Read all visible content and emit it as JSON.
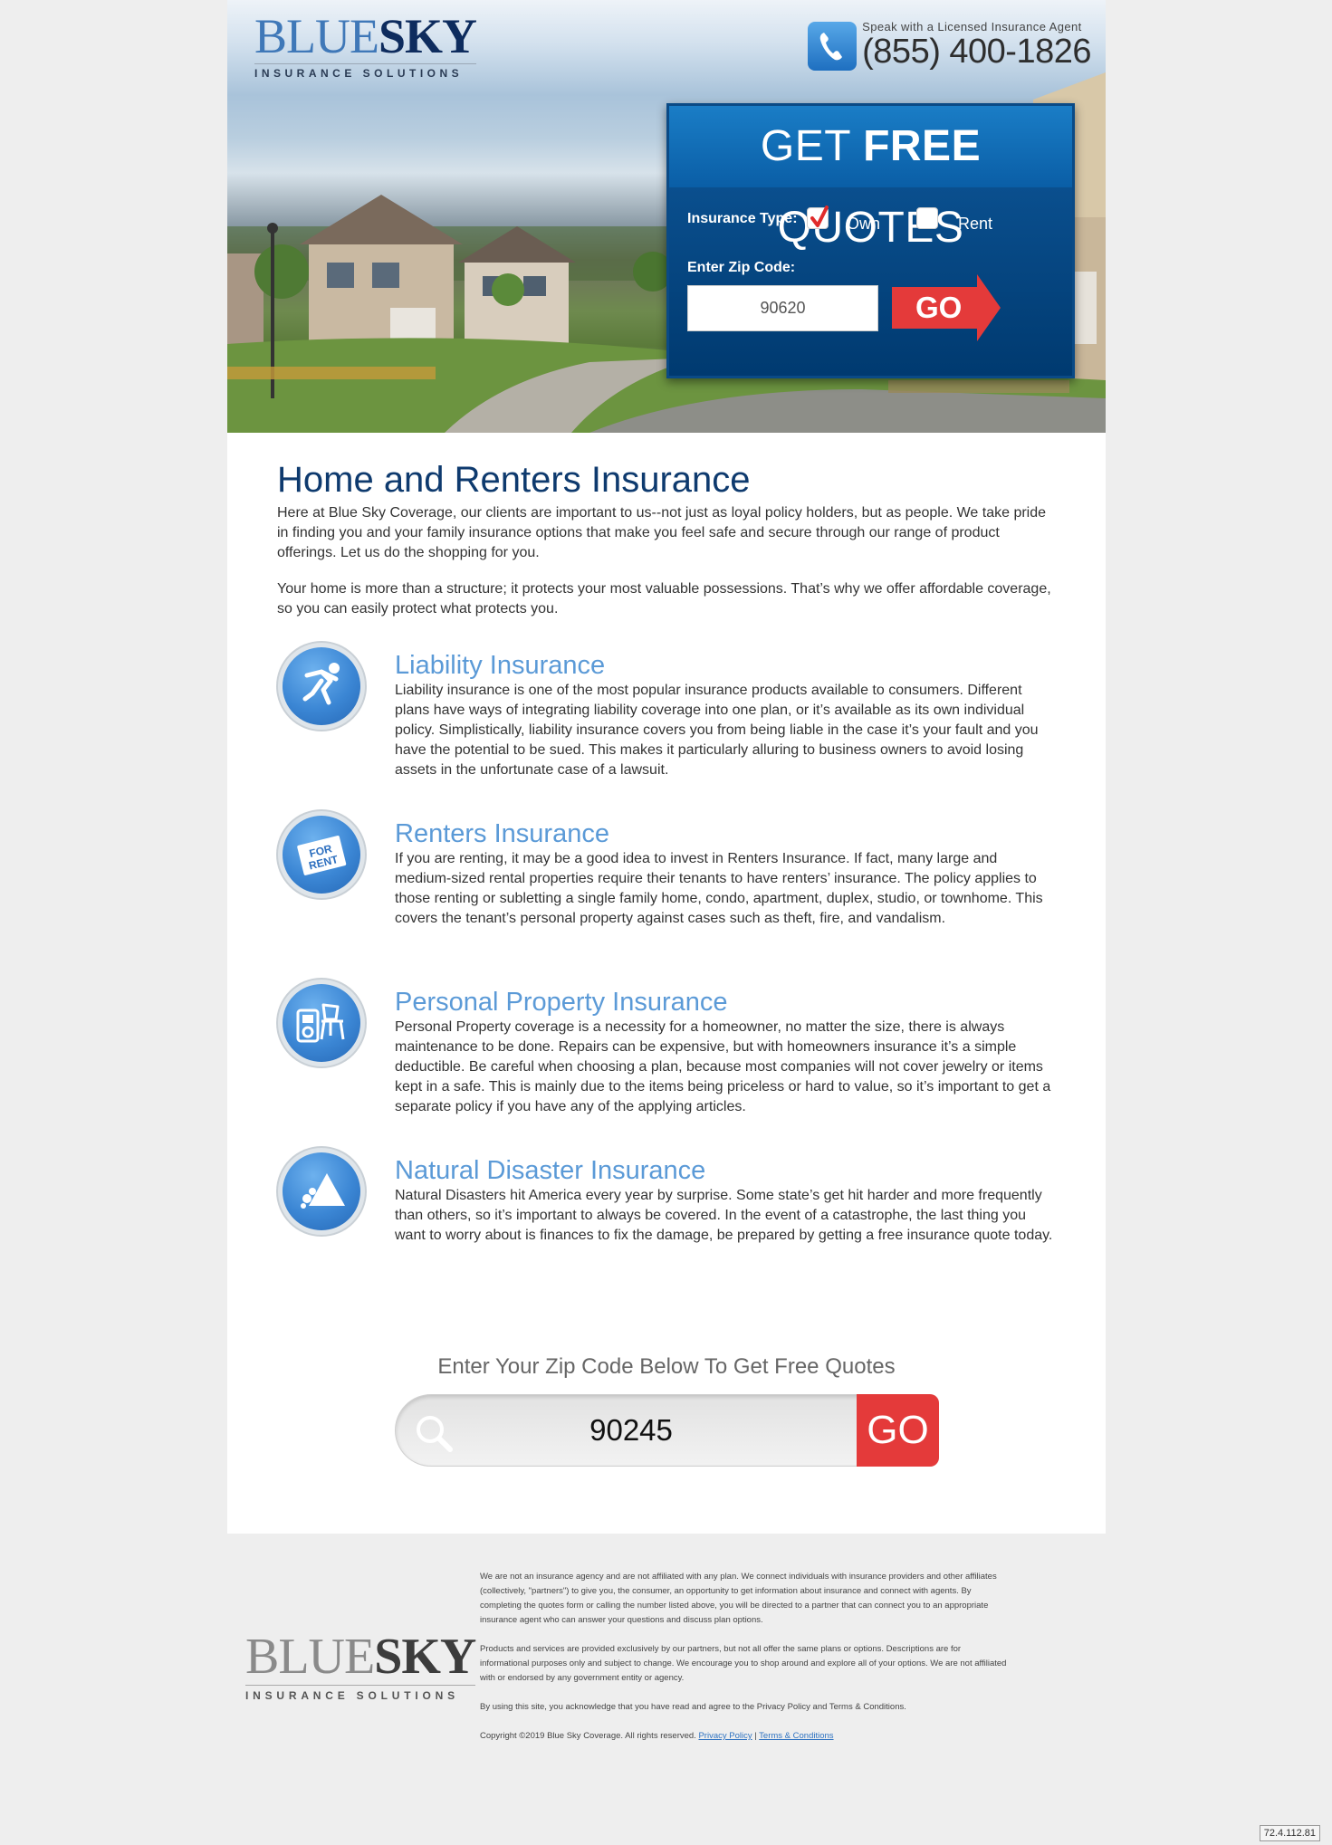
{
  "brand": {
    "name_part1": "BLUE",
    "name_part2": "SKY",
    "tagline": "INSURANCE SOLUTIONS"
  },
  "phone": {
    "label": "Speak with a Licensed Insurance Agent",
    "number": "(855) 400-1826"
  },
  "quote_form": {
    "title_part1": "GET ",
    "title_bold": "FREE",
    "title_part2": " QUOTES",
    "insurance_type_label": "Insurance Type:",
    "options": [
      {
        "label": "Own",
        "checked": true
      },
      {
        "label": "Rent",
        "checked": false
      }
    ],
    "zip_label": "Enter Zip Code:",
    "zip_value": "90620",
    "go_label": "GO"
  },
  "main": {
    "title": "Home and Renters Insurance",
    "intro": [
      "Here at Blue Sky Coverage, our clients are important to us--not just as loyal policy holders, but as people. We take pride in finding you and your family insurance options that make you feel safe and secure through our range of product offerings. Let us do the shopping for you.",
      "Your home is more than a structure; it protects your most valuable possessions. That’s why we offer affordable coverage, so you can easily protect what protects you."
    ],
    "services": [
      {
        "icon": "falling-person-icon",
        "title": "Liability Insurance",
        "text": "Liability insurance is one of the most popular insurance products available to consumers. Different plans have ways of integrating liability coverage into one plan, or it’s available as its own individual policy. Simplistically, liability insurance covers you from being liable in the case it’s your fault and you have the potential to be sued. This makes it particularly alluring to business owners to avoid losing assets in the unfortunate case of a lawsuit."
      },
      {
        "icon": "for-rent-sign-icon",
        "icon_text_1": "FOR",
        "icon_text_2": "RENT",
        "title": "Renters Insurance",
        "text": "If you are renting, it may be a good idea to invest in Renters Insurance. If fact, many large and medium-sized rental properties require their tenants to have renters’ insurance. The policy applies to those renting or subletting a single family home, condo, apartment, duplex, studio, or townhome. This covers the tenant’s personal property against cases such as theft, fire, and vandalism."
      },
      {
        "icon": "ipod-and-chair-icon",
        "title": "Personal Property Insurance",
        "text": "Personal Property coverage is a necessity for a homeowner, no matter the size, there is always maintenance to be done. Repairs can be expensive, but with homeowners insurance it’s a simple deductible. Be careful when choosing a plan, because most companies will not cover jewelry or items kept in a safe. This is mainly due to the items being priceless or hard to value, so it’s important to get a separate policy if you have any of the applying articles."
      },
      {
        "icon": "rockslide-warning-icon",
        "title": "Natural Disaster Insurance",
        "text": "Natural Disasters hit America every year by surprise. Some state’s get hit harder and more frequently than others, so it’s important to always be covered. In the event of a catastrophe, the last thing you want to worry about is finances to fix the damage, be prepared by getting a free insurance quote today."
      }
    ]
  },
  "zip_cta": {
    "title": "Enter Your Zip Code Below To Get Free Quotes",
    "value": "90245",
    "go_label": "GO"
  },
  "footer": {
    "paragraph1": "We are not an insurance agency and are not affiliated with any plan. We connect individuals with insurance providers and other affiliates (collectively, \"partners\") to give you, the consumer, an opportunity to get information about insurance and connect with agents. By completing the quotes form or calling the number listed above, you will be directed to a partner that can connect you to an appropriate insurance agent who can answer your questions and discuss plan options.",
    "paragraph2": "Products and services are provided exclusively by our partners, but not all offer the same plans or options. Descriptions are for informational purposes only and subject to change. We encourage you to shop around and explore all of your options. We are not affiliated with or endorsed by any government entity or agency.",
    "paragraph3": "By using this site, you acknowledge that you have read and agree to the Privacy Policy and Terms & Conditions.",
    "copyright": "Copyright ©2019 Blue Sky Coverage. All rights reserved.",
    "privacy_link": "Privacy Policy",
    "separator": "|",
    "terms_link": "Terms & Conditions"
  },
  "ip_badge": "72.4.112.81",
  "colors": {
    "navy": "#003b73",
    "accent_blue": "#5b9ad7",
    "title_blue": "#0e3a6e",
    "cta_red": "#e43a3a"
  }
}
